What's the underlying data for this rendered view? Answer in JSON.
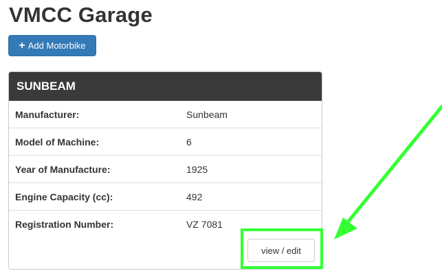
{
  "page": {
    "title": "VMCC Garage"
  },
  "toolbar": {
    "add_icon": "plus-icon",
    "add_label": "Add Motorbike"
  },
  "motorbike_card": {
    "heading": "SUNBEAM",
    "rows": [
      {
        "label": "Manufacturer:",
        "value": "Sunbeam"
      },
      {
        "label": "Model of Machine:",
        "value": "6"
      },
      {
        "label": "Year of Manufacture:",
        "value": "1925"
      },
      {
        "label": "Engine Capacity (cc):",
        "value": "492"
      },
      {
        "label": "Registration Number:",
        "value": "VZ 7081"
      }
    ],
    "view_edit_label": "view / edit"
  },
  "annotation": {
    "color": "#33ff33",
    "arrow_icon": "arrow-icon"
  }
}
